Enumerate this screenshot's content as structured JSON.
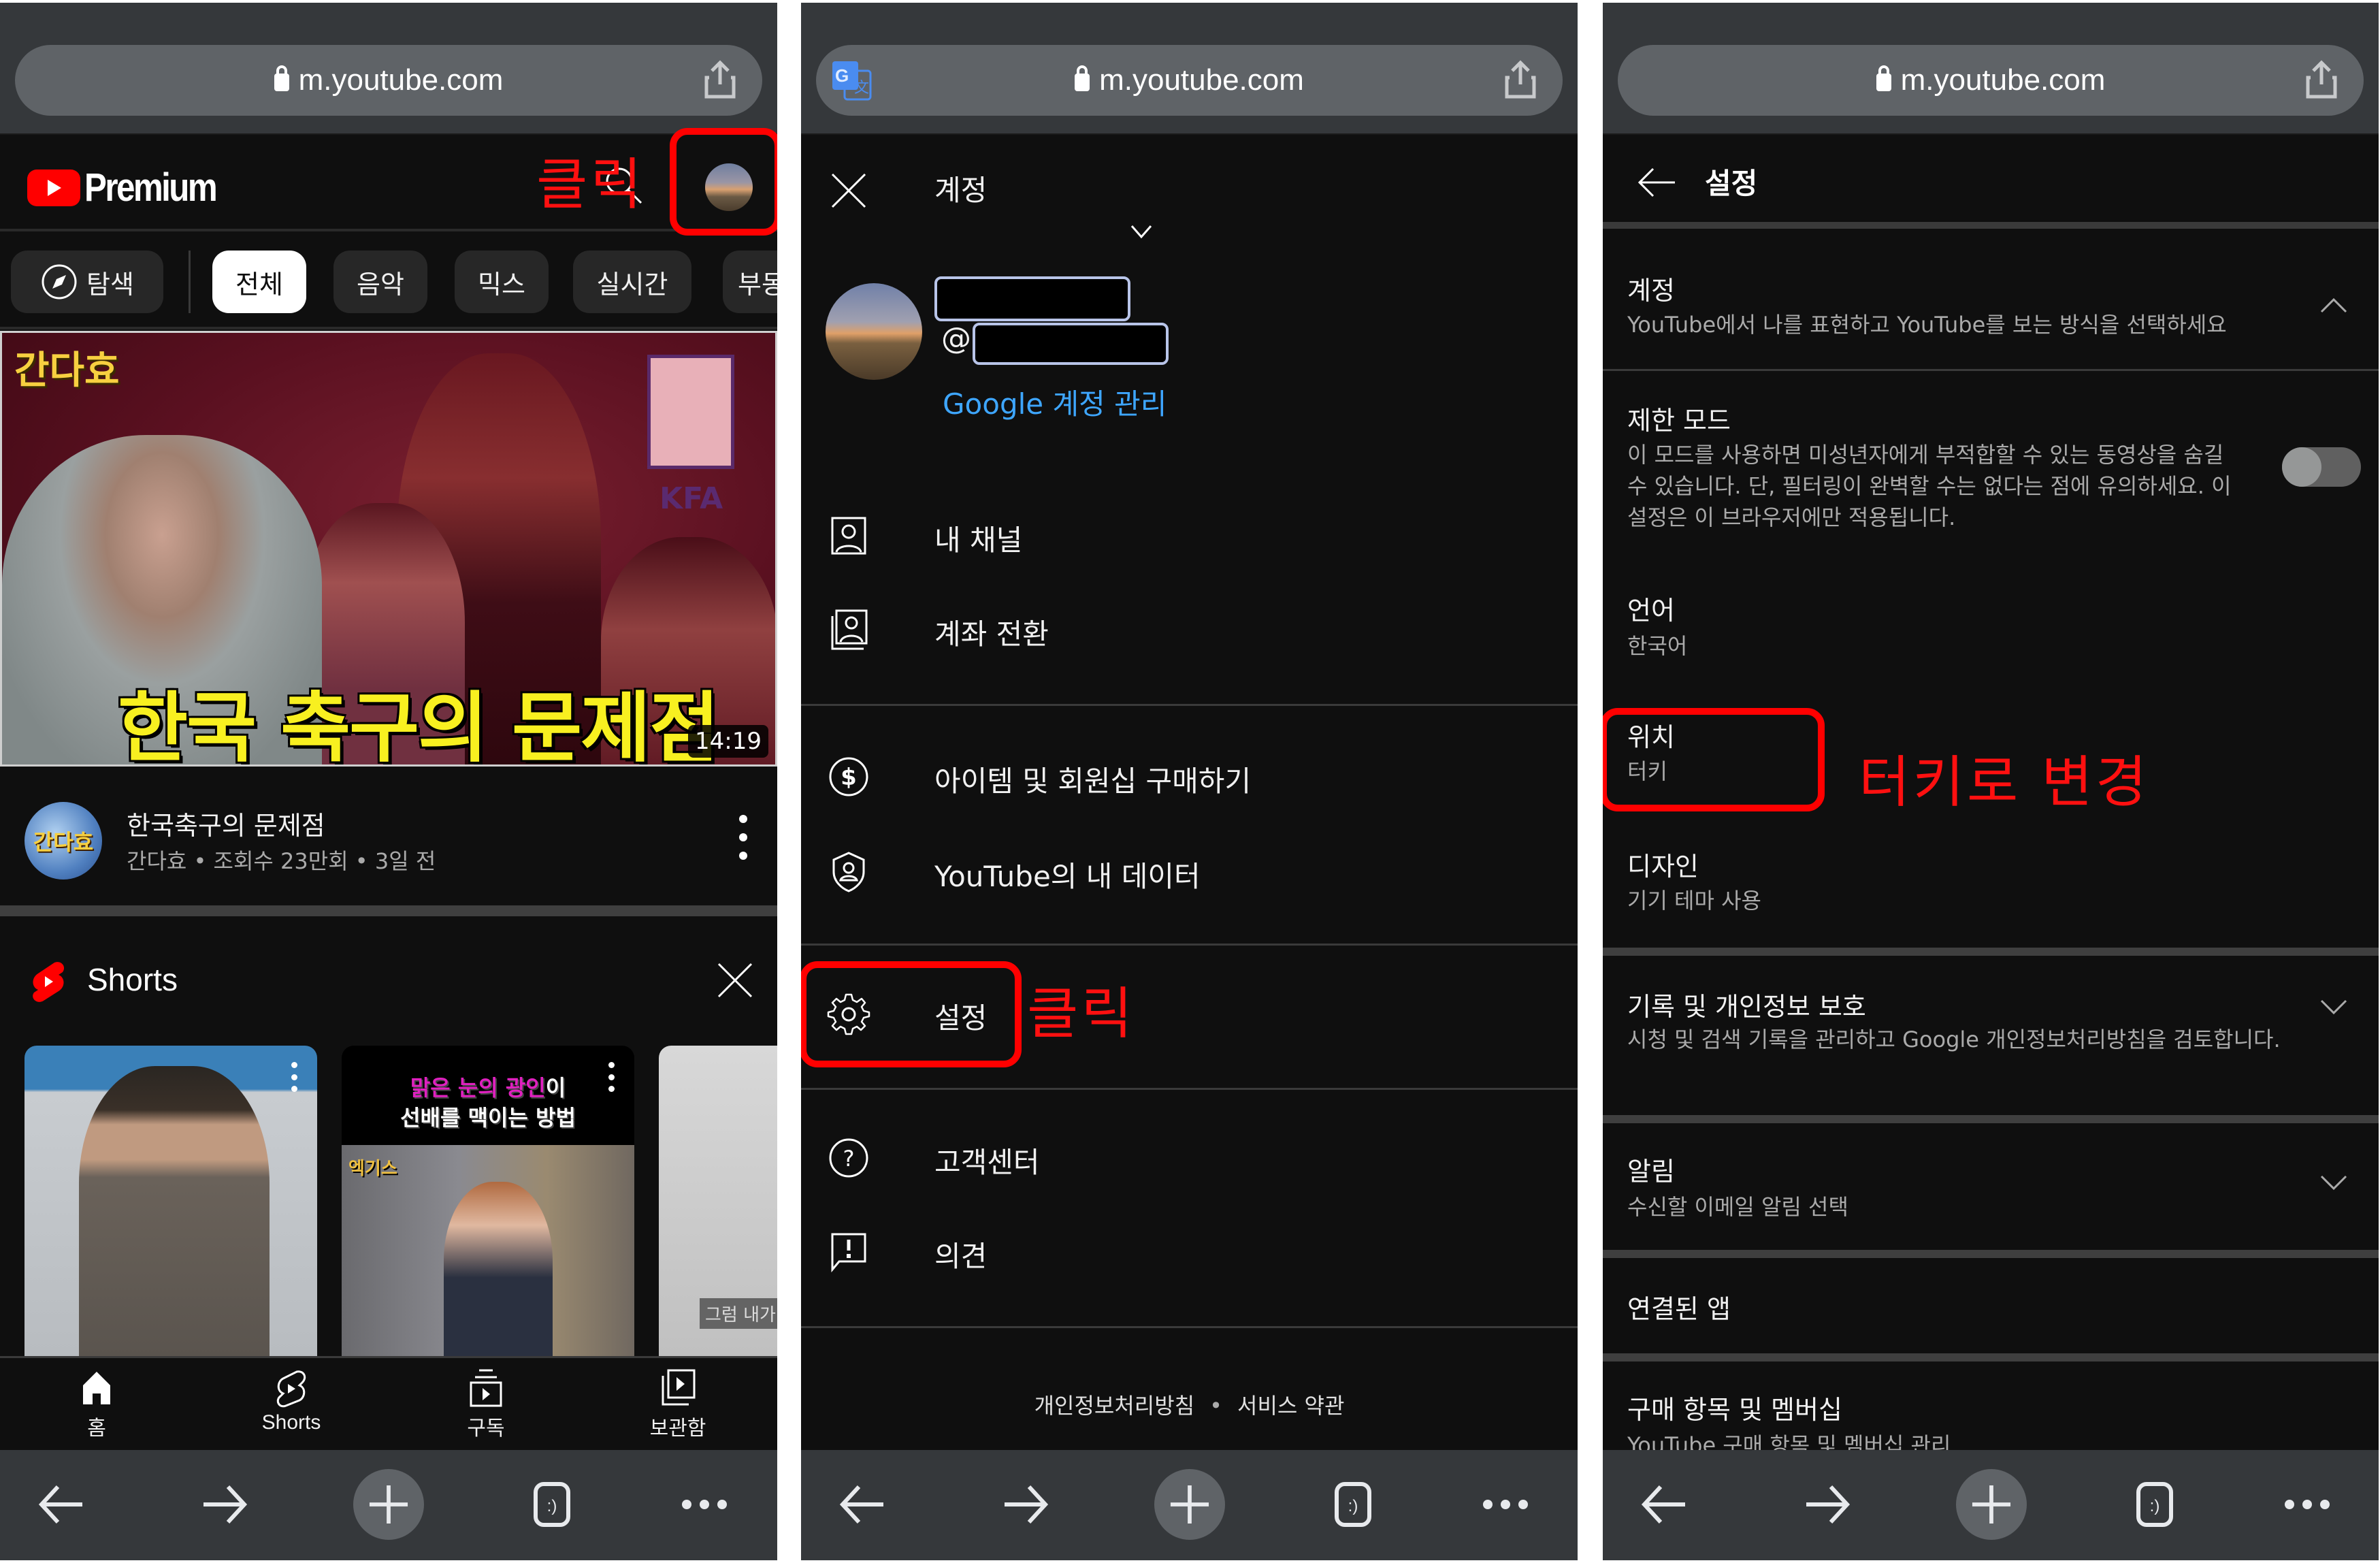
{
  "browser": {
    "url": "m.youtube.com",
    "icons": {
      "lock": "lock-icon",
      "share": "share-icon",
      "translate": "google-translate-icon"
    },
    "bottom_bar": [
      "back-arrow-icon",
      "forward-arrow-icon",
      "new-tab-plus-icon",
      "tabs-smiley-icon",
      "more-dots-icon"
    ]
  },
  "panel1": {
    "logo_text": "Premium",
    "annotation": "클릭",
    "chips": [
      {
        "label": "탐색",
        "icon": "compass-icon"
      },
      {
        "label": "전체",
        "active": true
      },
      {
        "label": "음악"
      },
      {
        "label": "믹스"
      },
      {
        "label": "실시간"
      },
      {
        "label": "부동"
      }
    ],
    "video": {
      "thumb_channel_text": "간다효",
      "thumb_title": "한국 축구의 문제점",
      "thumb_badge": "KFA",
      "duration": "14:19",
      "channel_avatar_text": "간다효",
      "title": "한국축구의 문제점",
      "subtitle": "간다효 • 조회수 23만회 • 3일 전"
    },
    "shorts": {
      "title": "Shorts",
      "cards": [
        {
          "caption_pink": "",
          "caption": ""
        },
        {
          "caption_pink": "맑은 눈의 광인",
          "caption_tail": "이",
          "caption_line2": "선배를 맥이는 방법",
          "brand": "엑기스"
        },
        {
          "subtitle": "그럼 내가 할"
        }
      ]
    },
    "tabs": [
      {
        "label": "홈",
        "icon": "home-icon"
      },
      {
        "label": "Shorts",
        "icon": "shorts-icon"
      },
      {
        "label": "구독",
        "icon": "subscriptions-icon"
      },
      {
        "label": "보관함",
        "icon": "library-icon"
      }
    ]
  },
  "panel2": {
    "title": "계정",
    "at_prefix": "@",
    "manage_account": "Google 계정 관리",
    "menu_groups": [
      [
        {
          "label": "내 채널",
          "icon": "person-box-icon"
        },
        {
          "label": "계좌 전환",
          "icon": "switch-account-icon"
        }
      ],
      [
        {
          "label": "아이템 및 회원십 구매하기",
          "icon": "dollar-circle-icon"
        },
        {
          "label": "YouTube의 내 데이터",
          "icon": "shield-person-icon"
        }
      ],
      [
        {
          "label": "설정",
          "icon": "gear-icon"
        }
      ],
      [
        {
          "label": "고객센터",
          "icon": "help-circle-icon"
        },
        {
          "label": "의견",
          "icon": "feedback-icon"
        }
      ]
    ],
    "annotation": "클릭",
    "footer": {
      "privacy": "개인정보처리방침",
      "separator": "•",
      "terms": "서비스 약관"
    }
  },
  "panel3": {
    "title": "설정",
    "items": [
      {
        "title": "계정",
        "desc": "YouTube에서 나를 표현하고 YouTube를 보는 방식을 선택하세요",
        "chevron": "up"
      },
      {
        "title": "제한 모드",
        "desc": "이 모드를 사용하면 미성년자에게 부적합할 수 있는 동영상을 숨길 수 있습니다. 단, 필터링이 완벽할 수는 없다는 점에 유의하세요. 이 설정은 이 브라우저에만 적용됩니다.",
        "toggle_on": false
      },
      {
        "title": "언어",
        "value": "한국어"
      },
      {
        "title": "위치",
        "value": "터키"
      },
      {
        "title": "디자인",
        "value": "기기 테마 사용"
      },
      {
        "title": "기록 및 개인정보 보호",
        "desc": "시청 및 검색 기록을 관리하고 Google 개인정보처리방침을 검토합니다.",
        "chevron": "down"
      },
      {
        "title": "알림",
        "desc": "수신할 이메일 알림 선택",
        "chevron": "down"
      },
      {
        "title": "연결된 앱"
      },
      {
        "title": "구매 항목 및 멤버십",
        "desc": "YouTube 구매 항목 및 멤버십 관리"
      }
    ],
    "annotation": "터키로 변경"
  },
  "colors": {
    "annotation_red": "#ff0000",
    "link_blue": "#3ea6ff",
    "yt_red": "#ff0000",
    "background": "#0f0f0f",
    "chrome": "#35383b"
  }
}
